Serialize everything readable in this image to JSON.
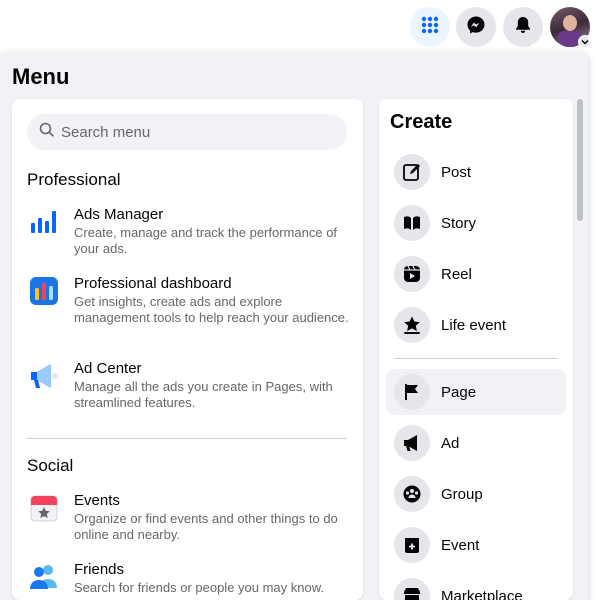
{
  "topbar": {
    "icons": [
      "apps-grid-icon",
      "messenger-icon",
      "bell-icon",
      "profile-avatar"
    ]
  },
  "menu": {
    "title": "Menu",
    "search_placeholder": "Search menu"
  },
  "left": {
    "sections": [
      {
        "title": "Professional",
        "items": [
          {
            "icon": "bar-chart-icon",
            "name": "Ads Manager",
            "desc": "Create, manage and track the performance of your ads."
          },
          {
            "icon": "dashboard-icon",
            "name": "Professional dashboard",
            "desc": "Get insights, create ads and explore management tools to help reach your audience."
          },
          {
            "icon": "megaphone-icon",
            "name": "Ad Center",
            "desc": "Manage all the ads you create in Pages, with streamlined features."
          }
        ]
      },
      {
        "title": "Social",
        "items": [
          {
            "icon": "calendar-icon",
            "name": "Events",
            "desc": "Organize or find events and other things to do online and nearby."
          },
          {
            "icon": "friends-icon",
            "name": "Friends",
            "desc": "Search for friends or people you may know."
          }
        ]
      }
    ]
  },
  "create": {
    "title": "Create",
    "items": [
      {
        "icon": "edit-icon",
        "label": "Post"
      },
      {
        "icon": "book-icon",
        "label": "Story"
      },
      {
        "icon": "reel-icon",
        "label": "Reel"
      },
      {
        "icon": "star-icon",
        "label": "Life event"
      },
      {
        "icon": "flag-icon",
        "label": "Page"
      },
      {
        "icon": "megaphone-icon",
        "label": "Ad"
      },
      {
        "icon": "group-icon",
        "label": "Group"
      },
      {
        "icon": "event-icon",
        "label": "Event"
      },
      {
        "icon": "marketplace-icon",
        "label": "Marketplace"
      }
    ]
  },
  "colors": {
    "accent": "#0866ff",
    "panel_bg": "#f0f2f5",
    "card_bg": "#ffffff",
    "secondary_text": "#65676b"
  }
}
